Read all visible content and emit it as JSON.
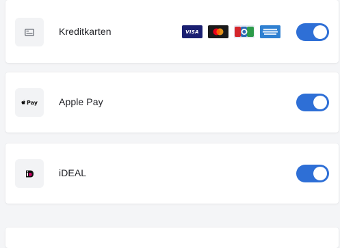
{
  "payment_methods": [
    {
      "label": "Kreditkarten",
      "icon": "credit-card-icon",
      "enabled": true,
      "card_brands": [
        {
          "name": "visa-card-icon",
          "text": "VISA",
          "color": "#1a1f71"
        },
        {
          "name": "mastercard-card-icon",
          "text": "",
          "color": "#1a1a1a"
        },
        {
          "name": "cb-card-icon",
          "text": "",
          "color": "#e6eaf3"
        },
        {
          "name": "amex-card-icon",
          "text": "",
          "color": "#2f80d1"
        }
      ]
    },
    {
      "label": "Apple Pay",
      "icon": "apple-pay-icon",
      "icon_text": "Pay",
      "enabled": true
    },
    {
      "label": "iDEAL",
      "icon": "ideal-icon",
      "enabled": true
    }
  ],
  "colors": {
    "toggle_on": "#2e6fd6",
    "background": "#f4f5f7",
    "card_background": "#ffffff"
  }
}
